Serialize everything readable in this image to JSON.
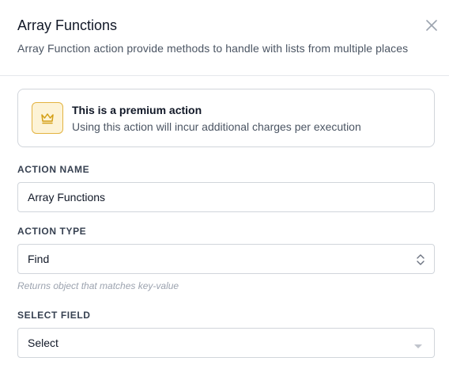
{
  "dialog": {
    "title": "Array Functions",
    "subtitle": "Array Function action provide methods to handle with lists from multiple places",
    "close_icon": "close-icon"
  },
  "premium": {
    "icon": "crown-icon",
    "title": "This is a premium action",
    "description": "Using this action will incur additional charges per execution",
    "accent_color": "#e3b341"
  },
  "form": {
    "action_name": {
      "label": "ACTION NAME",
      "value": "Array Functions"
    },
    "action_type": {
      "label": "ACTION TYPE",
      "value": "Find",
      "hint": "Returns object that matches key-value",
      "icon": "chevron-up-down-icon"
    },
    "select_field": {
      "label": "SELECT FIELD",
      "value": "Select",
      "icon": "caret-down-icon"
    }
  }
}
